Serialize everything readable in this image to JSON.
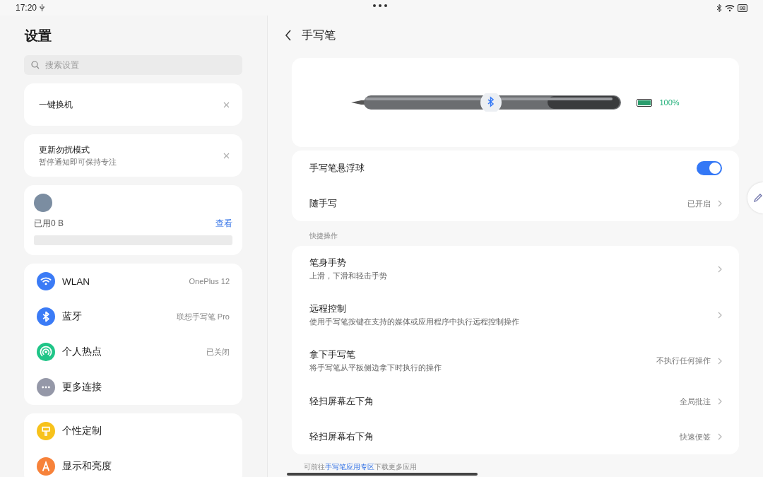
{
  "status_bar": {
    "time": "17:20",
    "battery": "98"
  },
  "sidebar": {
    "title": "设置",
    "search": {
      "placeholder": "搜索设置"
    },
    "suggestions": [
      {
        "title": "一键换机"
      },
      {
        "title": "更新勿扰模式",
        "subtitle": "暂停通知即可保持专注"
      }
    ],
    "storage": {
      "used": "已用0 B",
      "link": "查看"
    },
    "groups": [
      {
        "items": [
          {
            "kind": "wifi",
            "label": "WLAN",
            "value": "OnePlus 12",
            "color": "#3b7bf6"
          },
          {
            "kind": "bluetooth",
            "label": "蓝牙",
            "value": "联想手写笔 Pro",
            "color": "#3b7bf6"
          },
          {
            "kind": "hotspot",
            "label": "个人热点",
            "value": "已关闭",
            "color": "#1fc587"
          },
          {
            "kind": "more",
            "label": "更多连接",
            "color": "#9598a8"
          }
        ]
      },
      {
        "items": [
          {
            "kind": "brush",
            "label": "个性定制",
            "color": "#f7c21b"
          },
          {
            "kind": "display",
            "label": "显示和亮度",
            "color": "#f7823a"
          }
        ]
      }
    ]
  },
  "page": {
    "title": "手写笔",
    "battery": {
      "reading": "100%",
      "level": 1
    },
    "settings": [
      {
        "kind": "toggle",
        "label": "手写笔悬浮球",
        "on": true
      },
      {
        "kind": "link",
        "label": "随手写",
        "value": "已开启"
      }
    ],
    "section_label": "快捷操作",
    "actions": [
      {
        "label": "笔身手势",
        "subtitle": "上滑，下滑和轻击手势"
      },
      {
        "label": "远程控制",
        "subtitle": "使用手写笔按键在支持的媒体或应用程序中执行远程控制操作"
      },
      {
        "label": "拿下手写笔",
        "subtitle": "将手写笔从平板侧边拿下时执行的操作",
        "value": "不执行任何操作"
      },
      {
        "label": "轻扫屏幕左下角",
        "value": "全局批注"
      },
      {
        "label": "轻扫屏幕右下角",
        "value": "快速便签"
      }
    ],
    "footer": {
      "before": "可前往",
      "link": "手写笔应用专区",
      "after": "下载更多应用"
    }
  }
}
